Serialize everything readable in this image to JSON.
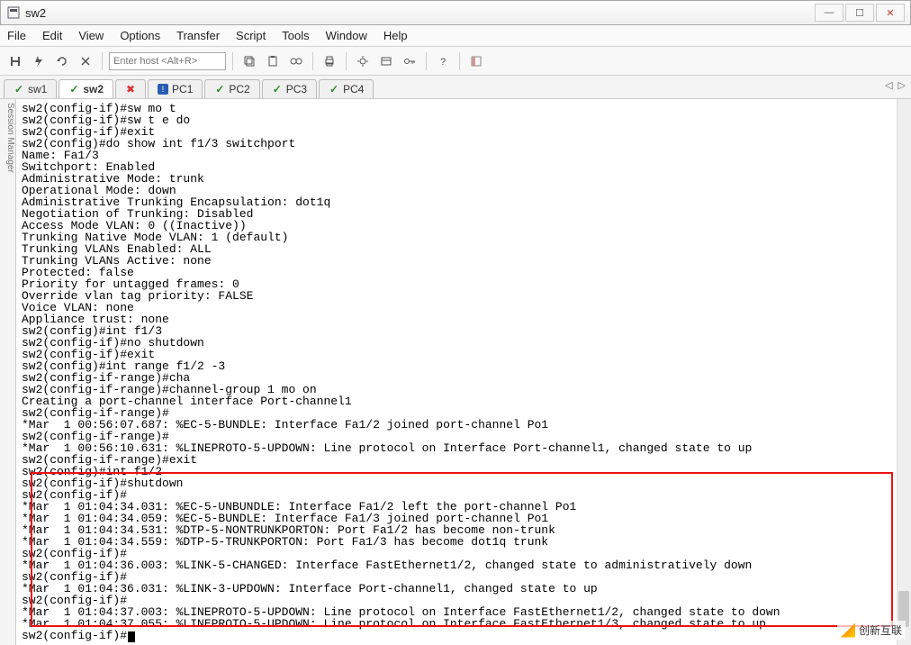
{
  "window": {
    "title": "sw2",
    "min": "—",
    "max": "☐",
    "close": "✕"
  },
  "menus": [
    "File",
    "Edit",
    "View",
    "Options",
    "Transfer",
    "Script",
    "Tools",
    "Window",
    "Help"
  ],
  "toolbar": {
    "host_placeholder": "Enter host <Alt+R>"
  },
  "tabs": [
    {
      "label": "sw1",
      "status": "check",
      "active": false
    },
    {
      "label": "sw2",
      "status": "check",
      "active": true
    },
    {
      "label": "",
      "status": "xred",
      "active": false
    },
    {
      "label": "PC1",
      "status": "bluewarn",
      "active": false
    },
    {
      "label": "PC2",
      "status": "check",
      "active": false
    },
    {
      "label": "PC3",
      "status": "check",
      "active": false
    },
    {
      "label": "PC4",
      "status": "check",
      "active": false
    }
  ],
  "tabnav": {
    "left": "◁",
    "right": "▷"
  },
  "sidebar_label": "Session Manager",
  "terminal_lines": [
    "sw2(config-if)#sw mo t",
    "sw2(config-if)#sw t e do",
    "sw2(config-if)#exit",
    "sw2(config)#do show int f1/3 switchport",
    "Name: Fa1/3",
    "Switchport: Enabled",
    "Administrative Mode: trunk",
    "Operational Mode: down",
    "Administrative Trunking Encapsulation: dot1q",
    "Negotiation of Trunking: Disabled",
    "Access Mode VLAN: 0 ((Inactive))",
    "Trunking Native Mode VLAN: 1 (default)",
    "Trunking VLANs Enabled: ALL",
    "Trunking VLANs Active: none",
    "Protected: false",
    "Priority for untagged frames: 0",
    "Override vlan tag priority: FALSE",
    "Voice VLAN: none",
    "Appliance trust: none",
    "sw2(config)#int f1/3",
    "sw2(config-if)#no shutdown",
    "sw2(config-if)#exit",
    "sw2(config)#int range f1/2 -3",
    "sw2(config-if-range)#cha",
    "sw2(config-if-range)#channel-group 1 mo on",
    "Creating a port-channel interface Port-channel1",
    "sw2(config-if-range)#",
    "*Mar  1 00:56:07.687: %EC-5-BUNDLE: Interface Fa1/2 joined port-channel Po1",
    "sw2(config-if-range)#",
    "*Mar  1 00:56:10.631: %LINEPROTO-5-UPDOWN: Line protocol on Interface Port-channel1, changed state to up",
    "sw2(config-if-range)#exit",
    "sw2(config)#int f1/2",
    "sw2(config-if)#shutdown",
    "sw2(config-if)#",
    "*Mar  1 01:04:34.031: %EC-5-UNBUNDLE: Interface Fa1/2 left the port-channel Po1",
    "*Mar  1 01:04:34.059: %EC-5-BUNDLE: Interface Fa1/3 joined port-channel Po1",
    "*Mar  1 01:04:34.531: %DTP-5-NONTRUNKPORTON: Port Fa1/2 has become non-trunk",
    "*Mar  1 01:04:34.559: %DTP-5-TRUNKPORTON: Port Fa1/3 has become dot1q trunk",
    "sw2(config-if)#",
    "*Mar  1 01:04:36.003: %LINK-5-CHANGED: Interface FastEthernet1/2, changed state to administratively down",
    "sw2(config-if)#",
    "*Mar  1 01:04:36.031: %LINK-3-UPDOWN: Interface Port-channel1, changed state to up",
    "sw2(config-if)#",
    "*Mar  1 01:04:37.003: %LINEPROTO-5-UPDOWN: Line protocol on Interface FastEthernet1/2, changed state to down",
    "*Mar  1 01:04:37.055: %LINEPROTO-5-UPDOWN: Line protocol on Interface FastEthernet1/3, changed state to up",
    "sw2(config-if)#"
  ],
  "watermark": "创新互联"
}
